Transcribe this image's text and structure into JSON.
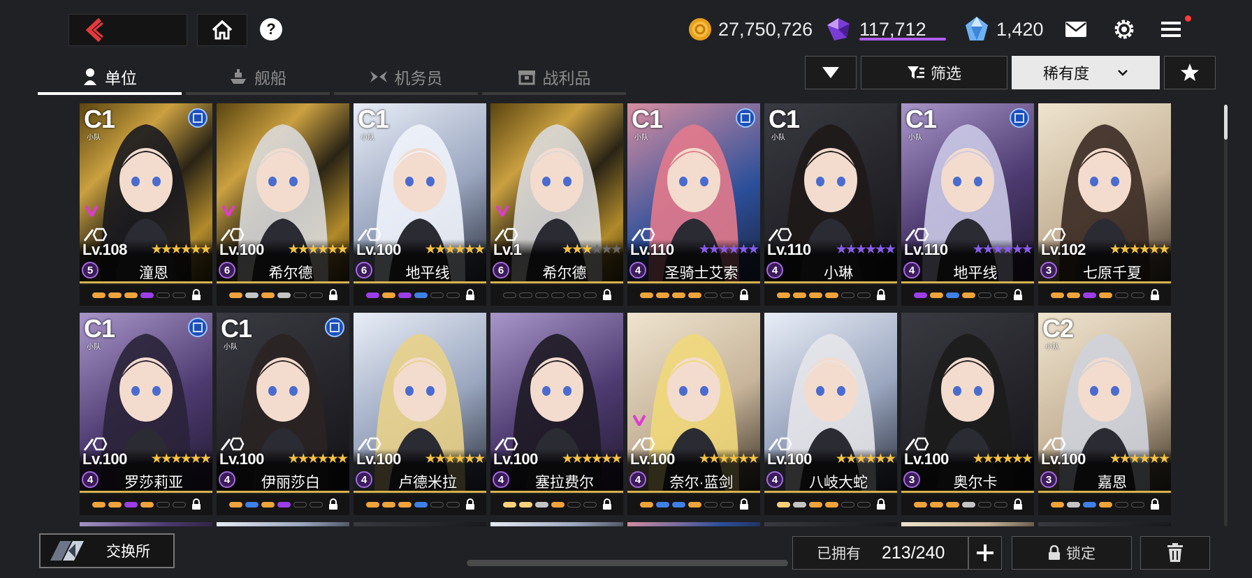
{
  "resources": {
    "gold": "27,750,726",
    "crystal": "117,712",
    "gem": "1,420"
  },
  "header": {
    "help_symbol": "?"
  },
  "tabs": [
    {
      "label": "单位",
      "icon": "person-icon",
      "active": true
    },
    {
      "label": "舰船",
      "icon": "ship-icon",
      "active": false
    },
    {
      "label": "机务员",
      "icon": "wings-icon",
      "active": false
    },
    {
      "label": "战利品",
      "icon": "loot-icon",
      "active": false
    }
  ],
  "controls": {
    "filter_label": "筛选",
    "sort_label": "稀有度"
  },
  "units": [
    {
      "grade": "C1",
      "sub": "小队",
      "badge": true,
      "v": true,
      "level": "Lv.108",
      "stars": 6,
      "star_color": "gold",
      "cost": "5",
      "name": "潼恩",
      "art": "gold",
      "gear": [
        "#f0a33a",
        "#f0a33a",
        "#f0a33a",
        "#9b3ee8",
        "none",
        "none"
      ]
    },
    {
      "grade": "",
      "sub": "",
      "badge": false,
      "v": true,
      "level": "Lv.100",
      "stars": 6,
      "star_color": "gold",
      "cost": "6",
      "name": "希尔德",
      "art": "gold",
      "gear": [
        "#f0a33a",
        "#c4c4c4",
        "#f0a33a",
        "#c4c4c4",
        "none",
        "none"
      ]
    },
    {
      "grade": "C1",
      "sub": "小队",
      "badge": false,
      "v": false,
      "level": "Lv.100",
      "stars": 6,
      "star_color": "gold",
      "cost": "6",
      "name": "地平线",
      "art": "light",
      "gear": [
        "#9b3ee8",
        "#f0a33a",
        "#9b3ee8",
        "#3f7fe8",
        "none",
        "none"
      ]
    },
    {
      "grade": "",
      "sub": "",
      "badge": false,
      "v": true,
      "level": "Lv.1",
      "stars": 3,
      "star_color": "gold",
      "cost": "6",
      "name": "希尔德",
      "art": "gold",
      "gear": [
        "none",
        "none",
        "none",
        "none",
        "none",
        "none"
      ]
    },
    {
      "grade": "C1",
      "sub": "小队",
      "badge": true,
      "v": false,
      "level": "Lv.110",
      "stars": 6,
      "star_color": "purple",
      "cost": "4",
      "name": "圣骑士艾索",
      "art": "pink",
      "gear": [
        "#f0a33a",
        "#f0a33a",
        "#f0a33a",
        "#f0a33a",
        "none",
        "none"
      ]
    },
    {
      "grade": "C1",
      "sub": "小队",
      "badge": false,
      "v": false,
      "level": "Lv.110",
      "stars": 6,
      "star_color": "purple",
      "cost": "4",
      "name": "小琳",
      "art": "dark",
      "gear": [
        "#f0a33a",
        "#f0a33a",
        "#f0a33a",
        "#f0a33a",
        "none",
        "none"
      ]
    },
    {
      "grade": "C1",
      "sub": "小队",
      "badge": true,
      "v": false,
      "level": "Lv.110",
      "stars": 6,
      "star_color": "purple",
      "cost": "4",
      "name": "地平线",
      "art": "purple",
      "gear": [
        "#9b3ee8",
        "#f0a33a",
        "#3f7fe8",
        "#f0a33a",
        "none",
        "none"
      ]
    },
    {
      "grade": "",
      "sub": "",
      "badge": false,
      "v": false,
      "level": "Lv.102",
      "stars": 6,
      "star_color": "gold",
      "cost": "3",
      "name": "七原千夏",
      "art": "cream",
      "gear": [
        "#f0a33a",
        "#f0a33a",
        "#9b3ee8",
        "#f0a33a",
        "none",
        "none"
      ]
    },
    {
      "grade": "C1",
      "sub": "小队",
      "badge": true,
      "v": false,
      "level": "Lv.100",
      "stars": 6,
      "star_color": "gold",
      "cost": "4",
      "name": "罗莎莉亚",
      "art": "purple",
      "gear": [
        "#f0a33a",
        "#f0a33a",
        "#9b3ee8",
        "#f0a33a",
        "none",
        "none"
      ]
    },
    {
      "grade": "C1",
      "sub": "小队",
      "badge": true,
      "v": false,
      "level": "Lv.100",
      "stars": 6,
      "star_color": "gold",
      "cost": "4",
      "name": "伊丽莎白",
      "art": "dark",
      "gear": [
        "#f0a33a",
        "#3f7fe8",
        "#f0a33a",
        "#9b3ee8",
        "none",
        "none"
      ]
    },
    {
      "grade": "",
      "sub": "",
      "badge": false,
      "v": false,
      "level": "Lv.100",
      "stars": 6,
      "star_color": "gold",
      "cost": "4",
      "name": "卢德米拉",
      "art": "light",
      "gear": [
        "#f0a33a",
        "#f0a33a",
        "#f0a33a",
        "#3f7fe8",
        "none",
        "none"
      ]
    },
    {
      "grade": "",
      "sub": "",
      "badge": false,
      "v": false,
      "level": "Lv.100",
      "stars": 6,
      "star_color": "gold",
      "cost": "4",
      "name": "塞拉费尔",
      "art": "purple",
      "gear": [
        "#f7d27a",
        "#f7d27a",
        "#c4c4c4",
        "#f0a33a",
        "none",
        "none"
      ]
    },
    {
      "grade": "",
      "sub": "",
      "badge": false,
      "v": true,
      "level": "Lv.100",
      "stars": 6,
      "star_color": "gold",
      "cost": "4",
      "name": "奈尔·蓝剑",
      "art": "cream",
      "gear": [
        "#f0a33a",
        "#3f7fe8",
        "#3f7fe8",
        "#f0a33a",
        "none",
        "none"
      ]
    },
    {
      "grade": "",
      "sub": "",
      "badge": false,
      "v": false,
      "level": "Lv.100",
      "stars": 6,
      "star_color": "gold",
      "cost": "4",
      "name": "八岐大蛇",
      "art": "light",
      "gear": [
        "#f7d27a",
        "#c4c4c4",
        "#f0a33a",
        "#f0a33a",
        "none",
        "none"
      ]
    },
    {
      "grade": "",
      "sub": "",
      "badge": false,
      "v": false,
      "level": "Lv.100",
      "stars": 6,
      "star_color": "gold",
      "cost": "3",
      "name": "奥尔卡",
      "art": "dark",
      "gear": [
        "#f0a33a",
        "#f0a33a",
        "#f0a33a",
        "#c4c4c4",
        "none",
        "none"
      ]
    },
    {
      "grade": "C2",
      "sub": "小队",
      "badge": false,
      "v": false,
      "level": "Lv.100",
      "stars": 6,
      "star_color": "gold",
      "cost": "3",
      "name": "嘉恩",
      "art": "cream",
      "gear": [
        "#f0a33a",
        "#c4c4c4",
        "#3f7fe8",
        "#f0a33a",
        "none",
        "none"
      ]
    }
  ],
  "bottom": {
    "exchange_label": "交换所",
    "owned_label": "已拥有",
    "owned_value": "213/240",
    "lock_label": "锁定"
  }
}
